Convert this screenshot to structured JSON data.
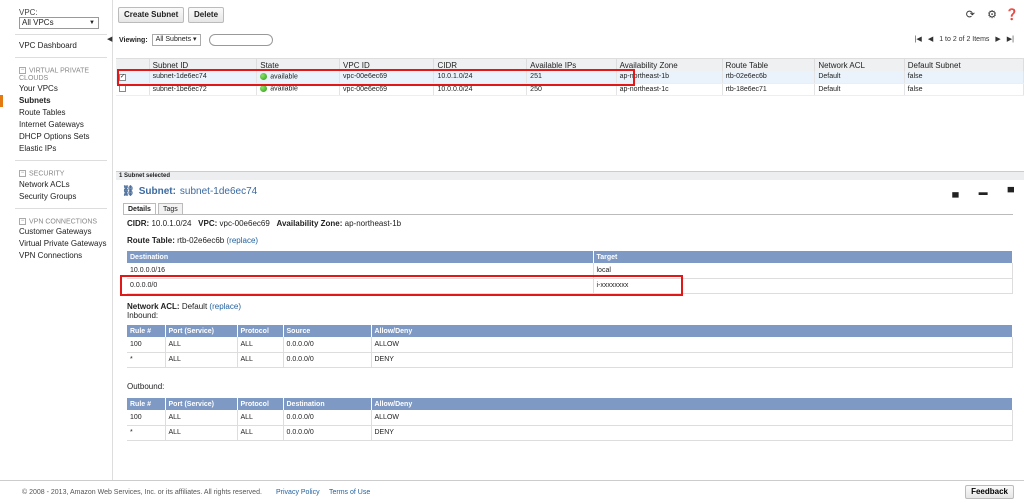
{
  "sidebar": {
    "vpc_label": "VPC:",
    "vpc_value": "All VPCs",
    "dashboard": "VPC Dashboard",
    "section1_title": "VIRTUAL PRIVATE",
    "section1_title2": "CLOUDS",
    "section1_items": [
      "Your VPCs",
      "Subnets",
      "Route Tables",
      "Internet Gateways",
      "DHCP Options Sets",
      "Elastic IPs"
    ],
    "section2_title": "SECURITY",
    "section2_items": [
      "Network ACLs",
      "Security Groups"
    ],
    "section3_title": "VPN CONNECTIONS",
    "section3_items": [
      "Customer Gateways",
      "Virtual Private Gateways",
      "VPN Connections"
    ]
  },
  "toolbar": {
    "create_label": "Create Subnet",
    "delete_label": "Delete"
  },
  "viewing": {
    "label": "Viewing:",
    "filter": "All Subnets"
  },
  "pager": {
    "text": "1 to 2 of 2 Items"
  },
  "grid": {
    "columns": [
      "",
      "Subnet ID",
      "State",
      "VPC ID",
      "CIDR",
      "Available IPs",
      "Availability Zone",
      "Route Table",
      "Network ACL",
      "Default Subnet"
    ],
    "rows": [
      {
        "checked": true,
        "subnet_id": "subnet-1de6ec74",
        "state": "available",
        "vpc_id": "vpc-00e6ec69",
        "cidr": "10.0.1.0/24",
        "ips": "251",
        "az": "ap-northeast-1b",
        "route": "rtb-02e6ec6b",
        "acl": "Default",
        "default": "false"
      },
      {
        "checked": false,
        "subnet_id": "subnet-1be6ec72",
        "state": "available",
        "vpc_id": "vpc-00e6ec69",
        "cidr": "10.0.0.0/24",
        "ips": "250",
        "az": "ap-northeast-1c",
        "route": "rtb-18e6ec71",
        "acl": "Default",
        "default": "false"
      }
    ]
  },
  "detail": {
    "selected_text": "1 Subnet selected",
    "title_prefix": "Subnet:",
    "title_id": "subnet-1de6ec74",
    "tabs": [
      "Details",
      "Tags"
    ],
    "cidr_label": "CIDR:",
    "cidr_value": "10.0.1.0/24",
    "vpc_label": "VPC:",
    "vpc_value": "vpc-00e6ec69",
    "az_label": "Availability Zone:",
    "az_value": "ap-northeast-1b",
    "rt_label": "Route Table:",
    "rt_value": "rtb-02e6ec6b",
    "replace": "(replace)",
    "routes_columns": [
      "Destination",
      "Target"
    ],
    "routes": [
      {
        "dest": "10.0.0.0/16",
        "target": "local"
      },
      {
        "dest": "0.0.0.0/0",
        "target": "i-xxxxxxxx"
      }
    ],
    "acl_label": "Network ACL:",
    "acl_value": "Default",
    "inbound_label": "Inbound:",
    "outbound_label": "Outbound:",
    "acl_columns": [
      "Rule #",
      "Port (Service)",
      "Protocol",
      "Source",
      "Allow/Deny"
    ],
    "acl_columns_out": [
      "Rule #",
      "Port (Service)",
      "Protocol",
      "Destination",
      "Allow/Deny"
    ],
    "inbound": [
      {
        "rule": "100",
        "port": "ALL",
        "proto": "ALL",
        "addr": "0.0.0.0/0",
        "action": "ALLOW"
      },
      {
        "rule": "*",
        "port": "ALL",
        "proto": "ALL",
        "addr": "0.0.0.0/0",
        "action": "DENY"
      }
    ],
    "outbound": [
      {
        "rule": "100",
        "port": "ALL",
        "proto": "ALL",
        "addr": "0.0.0.0/0",
        "action": "ALLOW"
      },
      {
        "rule": "*",
        "port": "ALL",
        "proto": "ALL",
        "addr": "0.0.0.0/0",
        "action": "DENY"
      }
    ]
  },
  "footer": {
    "copyright": "© 2008 - 2013, Amazon Web Services, Inc. or its affiliates. All rights reserved.",
    "privacy": "Privacy Policy",
    "terms": "Terms of Use",
    "feedback": "Feedback"
  },
  "colors": {
    "accent": "#e47911",
    "header_blue": "#7d99c4",
    "link": "#1f5f9e",
    "highlight": "#e01818"
  }
}
